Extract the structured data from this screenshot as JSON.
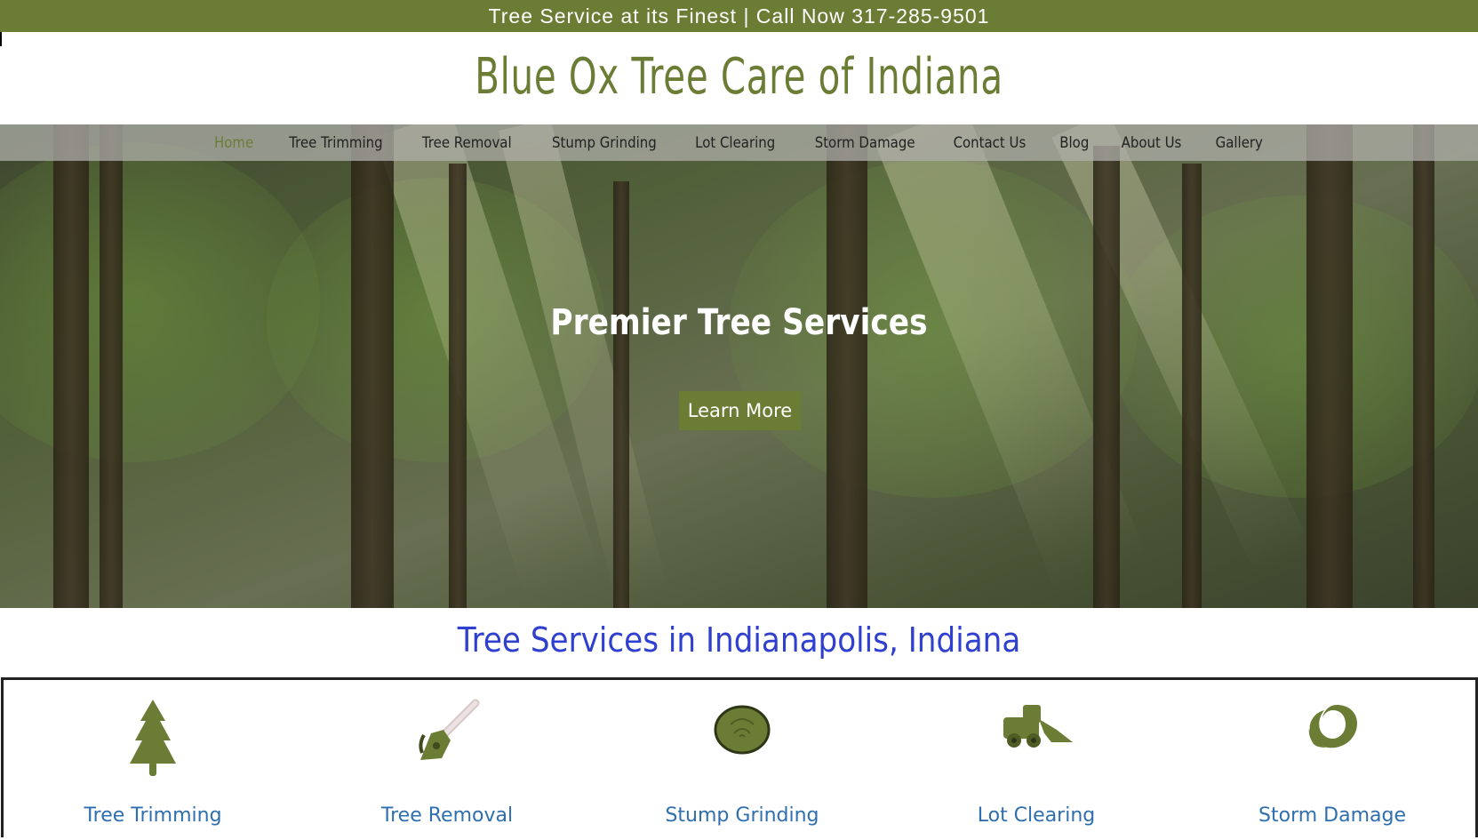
{
  "topbar": {
    "text": "Tree Service at its Finest | Call Now 317-285-9501"
  },
  "site": {
    "title": "Blue Ox Tree Care of Indiana"
  },
  "nav": {
    "items": [
      {
        "label": "Home",
        "active": true
      },
      {
        "label": "Tree Trimming"
      },
      {
        "label": "Tree Removal"
      },
      {
        "label": "Stump Grinding"
      },
      {
        "label": "Lot Clearing"
      },
      {
        "label": "Storm Damage"
      },
      {
        "label": "Contact Us"
      },
      {
        "label": "Blog"
      },
      {
        "label": "About Us"
      },
      {
        "label": "Gallery"
      }
    ]
  },
  "hero": {
    "title": "Premier Tree Services",
    "button_label": "Learn More"
  },
  "section": {
    "heading": "Tree Services in Indianapolis, Indiana"
  },
  "services": [
    {
      "label": "Tree Trimming",
      "icon": "pine-tree-icon"
    },
    {
      "label": "Tree Removal",
      "icon": "chainsaw-icon"
    },
    {
      "label": "Stump Grinding",
      "icon": "stump-icon"
    },
    {
      "label": "Lot Clearing",
      "icon": "skid-steer-icon"
    },
    {
      "label": "Storm Damage",
      "icon": "swirl-icon"
    }
  ],
  "colors": {
    "brand_green": "#6b7d35",
    "heading_blue": "#2f3fd0",
    "service_link_blue": "#2f6fb0"
  }
}
